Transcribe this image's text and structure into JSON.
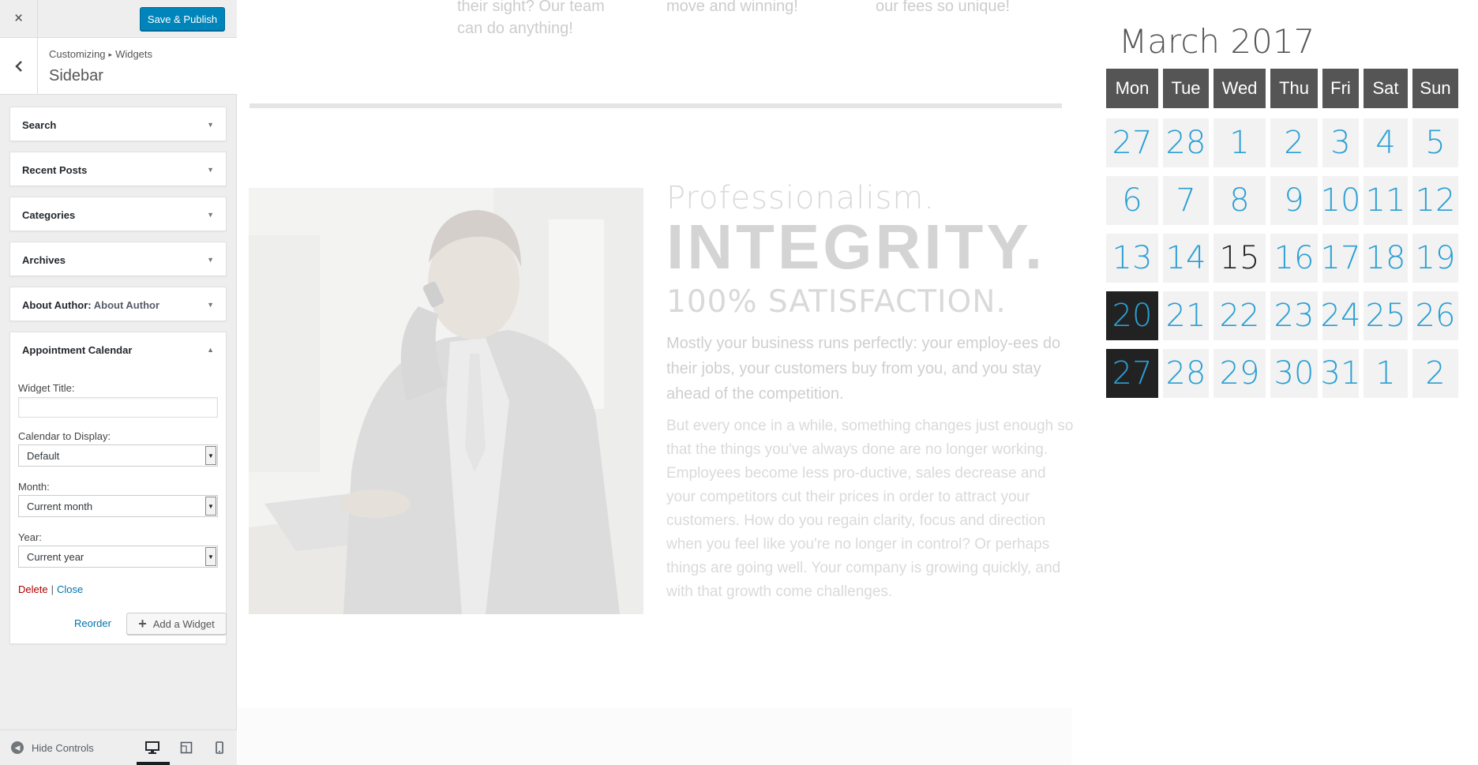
{
  "customizer": {
    "close_label": "×",
    "save_button": "Save & Publish",
    "back_label": "‹",
    "breadcrumb": {
      "root": "Customizing",
      "separator": "▸",
      "current": "Widgets"
    },
    "section_title": "Sidebar",
    "widgets": [
      {
        "title": "Search",
        "subtitle": ""
      },
      {
        "title": "Recent Posts",
        "subtitle": ""
      },
      {
        "title": "Categories",
        "subtitle": ""
      },
      {
        "title": "Archives",
        "subtitle": ""
      },
      {
        "title": "About Author:",
        "subtitle": "About Author"
      }
    ],
    "appointment_widget": {
      "title": "Appointment Calendar",
      "widget_title_label": "Widget Title:",
      "widget_title_value": "",
      "calendar_label": "Calendar to Display:",
      "calendar_value": "Default",
      "month_label": "Month:",
      "month_value": "Current month",
      "year_label": "Year:",
      "year_value": "Current year",
      "delete_label": "Delete",
      "pipe": "|",
      "close_label": "Close"
    },
    "reorder_label": "Reorder",
    "add_widget_label": "Add a Widget",
    "hide_controls_label": "Hide Controls"
  },
  "preview": {
    "top_snippets": [
      "their sight? Our team\ncan do anything!",
      "move and winning!",
      "our fees so unique!"
    ],
    "professionalism": "Professionalism.",
    "integrity": "INTEGRITY.",
    "satisfaction": "100% SATISFACTION.",
    "paragraph1": "Mostly your business runs perfectly: your employ-ees do their jobs, your customers buy from you, and you stay ahead of the competition.",
    "paragraph2": "But every once in a while, something changes just enough so that the things you've always done are no longer working. Employees become less pro-ductive, sales decrease and your competitors cut their prices in order to attract your customers. How do you regain clarity, focus and direction when you feel like you're no longer in control? Or perhaps things are going well. Your company is growing quickly, and with that growth come challenges."
  },
  "calendar": {
    "title": "March 2017",
    "weekdays": [
      "Mon",
      "Tue",
      "Wed",
      "Thu",
      "Fri",
      "Sat",
      "Sun"
    ],
    "weeks": [
      [
        "27",
        "28",
        "1",
        "2",
        "3",
        "4",
        "5"
      ],
      [
        "6",
        "7",
        "8",
        "9",
        "10",
        "11",
        "12"
      ],
      [
        "13",
        "14",
        "15",
        "16",
        "17",
        "18",
        "19"
      ],
      [
        "20",
        "21",
        "22",
        "23",
        "24",
        "25",
        "26"
      ],
      [
        "27",
        "28",
        "29",
        "30",
        "31",
        "1",
        "2"
      ]
    ],
    "today": "15",
    "highlighted_days": [
      "20",
      "27"
    ],
    "accent_color": "#2b9fd3"
  }
}
